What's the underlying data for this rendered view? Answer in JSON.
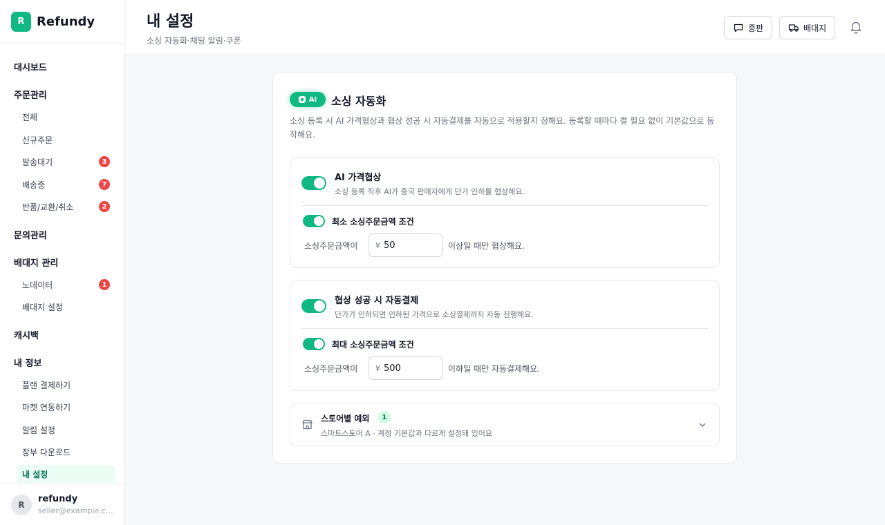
{
  "brand": {
    "logo_letter": "R",
    "name": "Refundy",
    "accent": "#10b981"
  },
  "sidebar": {
    "dashboard": "대시보드",
    "orders": {
      "label": "주문관리",
      "items": [
        {
          "label": "전체"
        },
        {
          "label": "신규주문"
        },
        {
          "label": "발송대기",
          "badge": "3"
        },
        {
          "label": "배송중",
          "badge": "7"
        },
        {
          "label": "반품/교환/취소",
          "badge": "2"
        }
      ]
    },
    "inquiries": "문의관리",
    "forwarding": {
      "label": "배대지 관리",
      "items": [
        {
          "label": "노데이터",
          "badge": "1"
        },
        {
          "label": "배대지 설정"
        }
      ]
    },
    "cashback": "캐시백",
    "my_info": {
      "label": "내 정보",
      "items": [
        {
          "label": "플랜 결제하기"
        },
        {
          "label": "마켓 연동하기"
        },
        {
          "label": "알림 설정"
        },
        {
          "label": "장부 다운로드"
        },
        {
          "label": "내 설정",
          "active": true
        }
      ]
    }
  },
  "user": {
    "avatar_letter": "R",
    "name": "refundy",
    "email": "seller@example.com"
  },
  "header": {
    "title": "내 설정",
    "subtitle": "소싱 자동화·채팅 알림·쿠폰",
    "buttons": {
      "chat": "중판",
      "forwarder": "배대지"
    }
  },
  "sourcing": {
    "pill": "AI",
    "title": "소싱 자동화",
    "description": "소싱 등록 시 AI 가격협상과 협상 성공 시 자동결제를 자동으로 적용할지 정해요. 등록할 때마다 켤 필요 없이 기본값으로 동작해요.",
    "negotiation": {
      "enabled": true,
      "title": "AI 가격협상",
      "description": "소싱 등록 직후 AI가 중국 판매자에게 단가 인하를 협상해요.",
      "condition": {
        "enabled": true,
        "title": "최소 소싱주문금액 조건",
        "label": "소싱주문금액이",
        "currency": "¥",
        "value": "50",
        "suffix": "이상일 때만 협상해요."
      }
    },
    "autopay": {
      "enabled": true,
      "title": "협상 성공 시 자동결제",
      "description": "단가가 인하되면 인하된 가격으로 소싱결제까지 자동 진행해요.",
      "condition": {
        "enabled": true,
        "title": "최대 소싱주문금액 조건",
        "label": "소싱주문금액이",
        "currency": "¥",
        "value": "500",
        "suffix": "이하일 때만 자동결제해요."
      }
    },
    "store_exceptions": {
      "title": "스토어별 예외",
      "count": "1",
      "description": "스마트스토어 A · 계정 기본값과 다르게 설정돼 있어요"
    }
  }
}
